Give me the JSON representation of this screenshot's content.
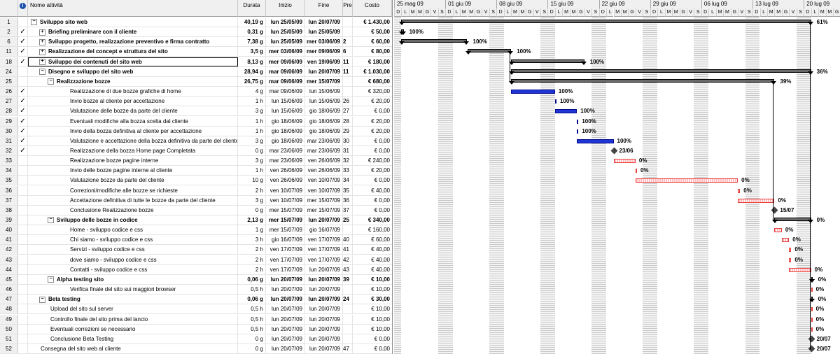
{
  "headers": {
    "info": "i",
    "name": "Nome attività",
    "duration": "Durata",
    "start": "Inizio",
    "finish": "Fine",
    "pred": "Pre",
    "cost": "Costo"
  },
  "timescale": {
    "weeks": [
      "25 mag 09",
      "01 giu 09",
      "08 giu 09",
      "15 giu 09",
      "22 giu 09",
      "29 giu 09",
      "06 lug 09",
      "13 lug 09",
      "20 lug 09"
    ],
    "days": [
      "D",
      "L",
      "M",
      "M",
      "G",
      "V",
      "S"
    ]
  },
  "rows": [
    {
      "id": "1",
      "check": false,
      "level": 0,
      "bold": true,
      "toggle": "−",
      "name": "Sviluppo sito web",
      "dur": "40,19 g",
      "start": "lun 25/05/09",
      "finish": "lun 20/07/09",
      "pred": "",
      "cost": "€ 1.430,00"
    },
    {
      "id": "2",
      "check": true,
      "level": 1,
      "bold": true,
      "toggle": "+",
      "name": "Briefing preliminare con il cliente",
      "dur": "0,31 g",
      "start": "lun 25/05/09",
      "finish": "lun 25/05/09",
      "pred": "",
      "cost": "€ 50,00"
    },
    {
      "id": "6",
      "check": true,
      "level": 1,
      "bold": true,
      "toggle": "+",
      "name": "Sviluppo progetto, realizzazione preventivo e firma contratto",
      "dur": "7,38 g",
      "start": "lun 25/05/09",
      "finish": "mer 03/06/09",
      "pred": "2",
      "cost": "€ 60,00"
    },
    {
      "id": "11",
      "check": true,
      "level": 1,
      "bold": true,
      "toggle": "+",
      "name": "Realizzazione del concept e struttura del sito",
      "dur": "3,5 g",
      "start": "mer 03/06/09",
      "finish": "mer 09/06/09",
      "pred": "6",
      "cost": "€ 80,00"
    },
    {
      "id": "18",
      "check": true,
      "level": 1,
      "bold": true,
      "toggle": "+",
      "name": "Sviluppo dei contenuti del sito web",
      "dur": "8,13 g",
      "start": "mer 09/06/09",
      "finish": "ven 19/06/09",
      "pred": "11",
      "cost": "€ 180,00",
      "selected": true
    },
    {
      "id": "24",
      "check": false,
      "level": 1,
      "bold": true,
      "toggle": "−",
      "name": "Disegno e sviluppo del sito web",
      "dur": "28,94 g",
      "start": "mar 09/06/09",
      "finish": "lun 20/07/09",
      "pred": "11",
      "cost": "€ 1.030,00"
    },
    {
      "id": "25",
      "check": false,
      "level": 2,
      "bold": true,
      "toggle": "−",
      "name": "Realizzazione bozze",
      "dur": "26,75 g",
      "start": "mar 09/06/09",
      "finish": "mer 15/07/09",
      "pred": "",
      "cost": "€ 680,00"
    },
    {
      "id": "26",
      "check": true,
      "level": 3,
      "bold": false,
      "toggle": "",
      "name": "Realizzazione di due bozze grafiche di home",
      "dur": "4 g",
      "start": "mar 09/06/09",
      "finish": "lun 15/06/09",
      "pred": "",
      "cost": "€ 320,00"
    },
    {
      "id": "27",
      "check": true,
      "level": 3,
      "bold": false,
      "toggle": "",
      "name": "Invio bozze al cliente per accettazione",
      "dur": "1 h",
      "start": "lun 15/06/09",
      "finish": "lun 15/06/09",
      "pred": "26",
      "cost": "€ 20,00"
    },
    {
      "id": "28",
      "check": true,
      "level": 3,
      "bold": false,
      "toggle": "",
      "name": "Valutazione delle bozze da parte del cliente",
      "dur": "3 g",
      "start": "lun 15/06/09",
      "finish": "gio 18/06/09",
      "pred": "27",
      "cost": "€ 0,00"
    },
    {
      "id": "29",
      "check": true,
      "level": 3,
      "bold": false,
      "toggle": "",
      "name": "Eventuali modifiche alla bozza scelta dal cliente",
      "dur": "1 h",
      "start": "gio 18/06/09",
      "finish": "gio 18/06/09",
      "pred": "28",
      "cost": "€ 20,00"
    },
    {
      "id": "30",
      "check": true,
      "level": 3,
      "bold": false,
      "toggle": "",
      "name": "Invio della bozza definitiva al cliente per accettazione",
      "dur": "1 h",
      "start": "gio 18/06/09",
      "finish": "gio 18/06/09",
      "pred": "29",
      "cost": "€ 20,00"
    },
    {
      "id": "31",
      "check": true,
      "level": 3,
      "bold": false,
      "toggle": "",
      "name": "Valutazione e accettazione della bozza definitiva da parte del cliente",
      "dur": "3 g",
      "start": "gio 18/06/09",
      "finish": "mar 23/06/09",
      "pred": "30",
      "cost": "€ 0,00"
    },
    {
      "id": "32",
      "check": true,
      "level": 3,
      "bold": false,
      "toggle": "",
      "name": "Realizzazione della bozza Home page Completata",
      "dur": "0 g",
      "start": "mar 23/06/09",
      "finish": "mar 23/06/09",
      "pred": "31",
      "cost": "€ 0,00"
    },
    {
      "id": "33",
      "check": false,
      "level": 3,
      "bold": false,
      "toggle": "",
      "name": "Realizzazione bozze pagine interne",
      "dur": "3 g",
      "start": "mar 23/06/09",
      "finish": "ven 26/06/09",
      "pred": "32",
      "cost": "€ 240,00"
    },
    {
      "id": "34",
      "check": false,
      "level": 3,
      "bold": false,
      "toggle": "",
      "name": "Invio delle bozze pagine interne al cliente",
      "dur": "1 h",
      "start": "ven 26/06/09",
      "finish": "ven 26/06/09",
      "pred": "33",
      "cost": "€ 20,00"
    },
    {
      "id": "35",
      "check": false,
      "level": 3,
      "bold": false,
      "toggle": "",
      "name": "Valutazione bozze da parte del cliente",
      "dur": "10 g",
      "start": "ven 26/06/09",
      "finish": "ven 10/07/09",
      "pred": "34",
      "cost": "€ 0,00"
    },
    {
      "id": "36",
      "check": false,
      "level": 3,
      "bold": false,
      "toggle": "",
      "name": "Correzioni/modifiche alle bozze se richieste",
      "dur": "2 h",
      "start": "ven 10/07/09",
      "finish": "ven 10/07/09",
      "pred": "35",
      "cost": "€ 40,00"
    },
    {
      "id": "37",
      "check": false,
      "level": 3,
      "bold": false,
      "toggle": "",
      "name": "Accettazione definitiva di tutte le bozze da parte del cliente",
      "dur": "3 g",
      "start": "ven 10/07/09",
      "finish": "mer 15/07/09",
      "pred": "36",
      "cost": "€ 0,00"
    },
    {
      "id": "38",
      "check": false,
      "level": 3,
      "bold": false,
      "toggle": "",
      "name": "Conclusione Realizzazione bozze",
      "dur": "0 g",
      "start": "mer 15/07/09",
      "finish": "mer 15/07/09",
      "pred": "37",
      "cost": "€ 0,00"
    },
    {
      "id": "39",
      "check": false,
      "level": 2,
      "bold": true,
      "toggle": "−",
      "name": "Sviluppo delle bozze in codice",
      "dur": "2,13 g",
      "start": "mer 15/07/09",
      "finish": "lun 20/07/09",
      "pred": "25",
      "cost": "€ 340,00"
    },
    {
      "id": "40",
      "check": false,
      "level": 3,
      "bold": false,
      "toggle": "",
      "name": "Home - sviluppo codice e css",
      "dur": "1 g",
      "start": "mer 15/07/09",
      "finish": "gio 16/07/09",
      "pred": "",
      "cost": "€ 160,00"
    },
    {
      "id": "41",
      "check": false,
      "level": 3,
      "bold": false,
      "toggle": "",
      "name": "Chi siamo - sviluppo codice e css",
      "dur": "3 h",
      "start": "gio 16/07/09",
      "finish": "ven 17/07/09",
      "pred": "40",
      "cost": "€ 60,00"
    },
    {
      "id": "42",
      "check": false,
      "level": 3,
      "bold": false,
      "toggle": "",
      "name": "Servizi - sviluppo codice e css",
      "dur": "2 h",
      "start": "ven 17/07/09",
      "finish": "ven 17/07/09",
      "pred": "41",
      "cost": "€ 40,00"
    },
    {
      "id": "43",
      "check": false,
      "level": 3,
      "bold": false,
      "toggle": "",
      "name": "dove siamo - sviluppo codice e css",
      "dur": "2 h",
      "start": "ven 17/07/09",
      "finish": "ven 17/07/09",
      "pred": "42",
      "cost": "€ 40,00"
    },
    {
      "id": "44",
      "check": false,
      "level": 3,
      "bold": false,
      "toggle": "",
      "name": "Contatti - sviluppo codice e css",
      "dur": "2 h",
      "start": "ven 17/07/09",
      "finish": "lun 20/07/09",
      "pred": "43",
      "cost": "€ 40,00"
    },
    {
      "id": "45",
      "check": false,
      "level": 2,
      "bold": true,
      "toggle": "−",
      "name": "Alpha testing sito",
      "dur": "0,06 g",
      "start": "lun 20/07/09",
      "finish": "lun 20/07/09",
      "pred": "39",
      "cost": "€ 10,00"
    },
    {
      "id": "46",
      "check": false,
      "level": 3,
      "bold": false,
      "toggle": "",
      "name": "Verifica finale del sito sui maggiori browser",
      "dur": "0,5 h",
      "start": "lun 20/07/09",
      "finish": "lun 20/07/09",
      "pred": "",
      "cost": "€ 10,00"
    },
    {
      "id": "47",
      "check": false,
      "level": 1,
      "bold": true,
      "toggle": "−",
      "name": "Beta testing",
      "dur": "0,06 g",
      "start": "lun 20/07/09",
      "finish": "lun 20/07/09",
      "pred": "24",
      "cost": "€ 30,00"
    },
    {
      "id": "48",
      "check": false,
      "level": 2,
      "bold": false,
      "toggle": "",
      "name": "Upload del sito sul server",
      "dur": "0,5 h",
      "start": "lun 20/07/09",
      "finish": "lun 20/07/09",
      "pred": "",
      "cost": "€ 10,00"
    },
    {
      "id": "49",
      "check": false,
      "level": 2,
      "bold": false,
      "toggle": "",
      "name": "Controllo finale del sito prima del lancio",
      "dur": "0,5 h",
      "start": "lun 20/07/09",
      "finish": "lun 20/07/09",
      "pred": "",
      "cost": "€ 10,00"
    },
    {
      "id": "50",
      "check": false,
      "level": 2,
      "bold": false,
      "toggle": "",
      "name": "Eventuali correzioni se necessario",
      "dur": "0,5 h",
      "start": "lun 20/07/09",
      "finish": "lun 20/07/09",
      "pred": "",
      "cost": "€ 10,00"
    },
    {
      "id": "51",
      "check": false,
      "level": 2,
      "bold": false,
      "toggle": "",
      "name": "Conclusione Beta Testing",
      "dur": "0 g",
      "start": "lun 20/07/09",
      "finish": "lun 20/07/09",
      "pred": "",
      "cost": "€ 0,00"
    },
    {
      "id": "52",
      "check": false,
      "level": 1,
      "bold": false,
      "toggle": "",
      "name": "Consegna del sito web al cliente",
      "dur": "0 g",
      "start": "lun 20/07/09",
      "finish": "lun 20/07/09",
      "pred": "47",
      "cost": "€ 0,00"
    }
  ],
  "bars": [
    {
      "type": "sum",
      "start": "2009-05-25",
      "end": "2009-07-20",
      "label": "61%"
    },
    {
      "type": "sum",
      "start": "2009-05-25",
      "end": "2009-05-25.3",
      "label": "100%"
    },
    {
      "type": "sum",
      "start": "2009-05-25",
      "end": "2009-06-03",
      "label": "100%"
    },
    {
      "type": "sum",
      "start": "2009-06-03",
      "end": "2009-06-09",
      "label": "100%"
    },
    {
      "type": "sum",
      "start": "2009-06-09",
      "end": "2009-06-19",
      "label": "100%"
    },
    {
      "type": "sum",
      "start": "2009-06-09",
      "end": "2009-07-20",
      "label": "36%"
    },
    {
      "type": "sum",
      "start": "2009-06-09",
      "end": "2009-07-15",
      "label": "39%"
    },
    {
      "type": "blue",
      "start": "2009-06-09",
      "end": "2009-06-15",
      "label": "100%"
    },
    {
      "type": "blue",
      "start": "2009-06-15",
      "end": "2009-06-15.2",
      "label": "100%"
    },
    {
      "type": "blue",
      "start": "2009-06-15",
      "end": "2009-06-18",
      "label": "100%"
    },
    {
      "type": "blue",
      "start": "2009-06-18",
      "end": "2009-06-18.2",
      "label": "100%"
    },
    {
      "type": "blue",
      "start": "2009-06-18",
      "end": "2009-06-18.2",
      "label": "100%"
    },
    {
      "type": "blue",
      "start": "2009-06-18",
      "end": "2009-06-23",
      "label": "100%"
    },
    {
      "type": "ms",
      "start": "2009-06-23",
      "label": "23/06"
    },
    {
      "type": "red",
      "start": "2009-06-23",
      "end": "2009-06-26",
      "label": "0%"
    },
    {
      "type": "red",
      "start": "2009-06-26",
      "end": "2009-06-26.2",
      "label": "0%"
    },
    {
      "type": "red",
      "start": "2009-06-26",
      "end": "2009-07-10",
      "label": "0%"
    },
    {
      "type": "red",
      "start": "2009-07-10",
      "end": "2009-07-10.3",
      "label": "0%"
    },
    {
      "type": "red",
      "start": "2009-07-10",
      "end": "2009-07-15",
      "label": "0%"
    },
    {
      "type": "ms",
      "start": "2009-07-15",
      "label": "15/07"
    },
    {
      "type": "sum",
      "start": "2009-07-15",
      "end": "2009-07-20",
      "label": "0%"
    },
    {
      "type": "red",
      "start": "2009-07-15",
      "end": "2009-07-16",
      "label": "0%"
    },
    {
      "type": "red",
      "start": "2009-07-16",
      "end": "2009-07-17",
      "label": "0%"
    },
    {
      "type": "red",
      "start": "2009-07-17",
      "end": "2009-07-17.3",
      "label": "0%"
    },
    {
      "type": "red",
      "start": "2009-07-17",
      "end": "2009-07-17.3",
      "label": "0%"
    },
    {
      "type": "red",
      "start": "2009-07-17",
      "end": "2009-07-20",
      "label": "0%"
    },
    {
      "type": "sum",
      "start": "2009-07-20",
      "end": "2009-07-20.1",
      "label": "0%"
    },
    {
      "type": "red",
      "start": "2009-07-20",
      "end": "2009-07-20.1",
      "label": "0%"
    },
    {
      "type": "sum",
      "start": "2009-07-20",
      "end": "2009-07-20.1",
      "label": "0%"
    },
    {
      "type": "red",
      "start": "2009-07-20",
      "end": "2009-07-20.1",
      "label": "0%"
    },
    {
      "type": "red",
      "start": "2009-07-20",
      "end": "2009-07-20.1",
      "label": "0%"
    },
    {
      "type": "red",
      "start": "2009-07-20",
      "end": "2009-07-20.1",
      "label": "0%"
    },
    {
      "type": "ms",
      "start": "2009-07-20",
      "label": "20/07"
    },
    {
      "type": "ms",
      "start": "2009-07-20",
      "label": "20/07"
    }
  ]
}
